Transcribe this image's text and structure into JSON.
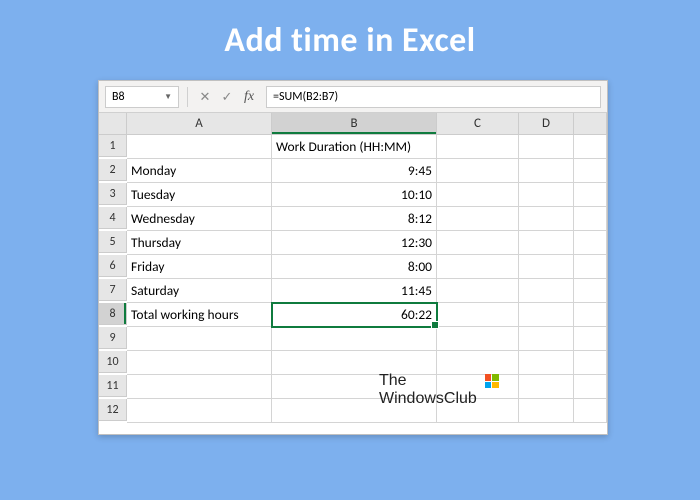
{
  "page": {
    "title": "Add time in Excel"
  },
  "formula_bar": {
    "cell_ref": "B8",
    "formula": "=SUM(B2:B7)"
  },
  "columns": [
    "A",
    "B",
    "C",
    "D"
  ],
  "rows": [
    "1",
    "2",
    "3",
    "4",
    "5",
    "6",
    "7",
    "8",
    "9",
    "10",
    "11",
    "12"
  ],
  "header_row": {
    "b1": "Work Duration (HH:MM)"
  },
  "data_rows": [
    {
      "label": "Monday",
      "value": "9:45"
    },
    {
      "label": "Tuesday",
      "value": "10:10"
    },
    {
      "label": "Wednesday",
      "value": "8:12"
    },
    {
      "label": "Thursday",
      "value": "12:30"
    },
    {
      "label": "Friday",
      "value": "8:00"
    },
    {
      "label": "Saturday",
      "value": "11:45"
    }
  ],
  "total_row": {
    "label": "Total working hours",
    "value": "60:22"
  },
  "watermark": {
    "line1": "The",
    "line2": "WindowsClub"
  },
  "active_cell": "B8"
}
